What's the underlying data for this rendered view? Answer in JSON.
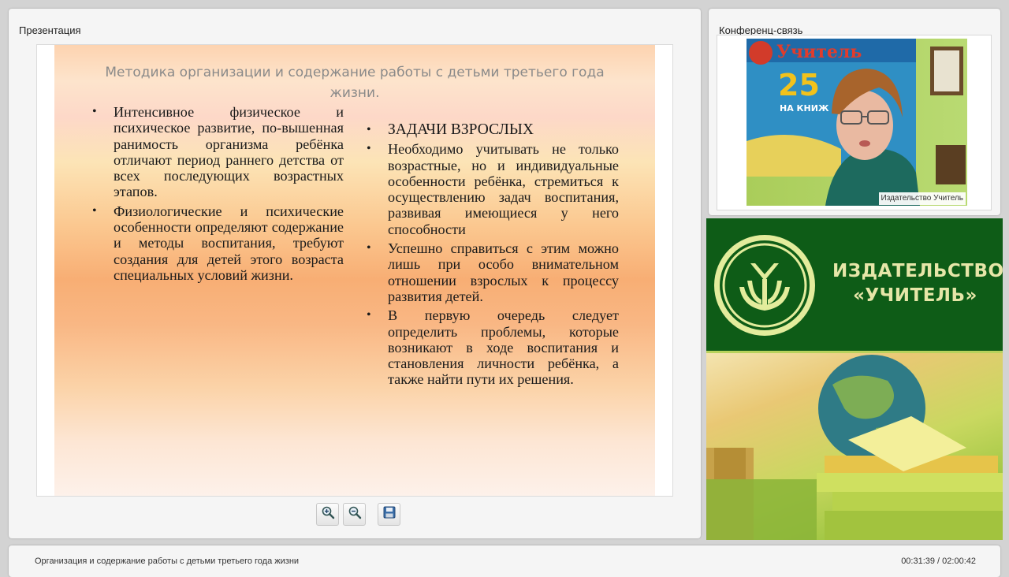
{
  "presentation_panel": {
    "title": "Презентация",
    "slide": {
      "title": "Методика организации и содержание работы с детьми третьего года жизни.",
      "left_bullets": [
        "Интенсивное физическое и психическое развитие, по-вышенная ранимость организма ребёнка отличают период раннего детства от всех последующих возрастных этапов.",
        "Физиологические и психические особенности определяют содержание и методы воспитания, требуют создания для детей этого возраста специальных условий жизни."
      ],
      "right_heading": "ЗАДАЧИ ВЗРОСЛЫХ",
      "right_bullets": [
        "Необходимо учитывать не только возрастные, но и индивидуальные особенности ребёнка, стремиться к осуществлению задач воспитания, развивая имеющиеся у него способности",
        "Успешно справиться с этим можно лишь при особо внимательном отношении взрослых к процессу развития детей.",
        "В первую очередь следует определить проблемы, которые возникают в ходе воспитания и становления личности ребёнка, а также найти пути их решения."
      ]
    },
    "toolbar": {
      "zoom_in_icon": "zoom-in-icon",
      "zoom_out_icon": "zoom-out-icon",
      "save_icon": "save-icon"
    }
  },
  "conference_panel": {
    "title": "Конференц-связь",
    "video": {
      "label": "Издательство Учитель",
      "poster_brand": "Учитель",
      "poster_number": "25",
      "poster_sub": "НА КНИЖ"
    }
  },
  "ad_banner": {
    "line1": "ИЗДАТЕЛЬСТВО",
    "line2": "«УЧИТЕЛЬ»"
  },
  "footer": {
    "lecture_title": "Организация и содержание работы с детьми третьего года жизни",
    "time": "00:31:39 / 02:00:42"
  },
  "colors": {
    "ad_green": "#0e5c17",
    "ad_text": "#e6e6a8"
  }
}
